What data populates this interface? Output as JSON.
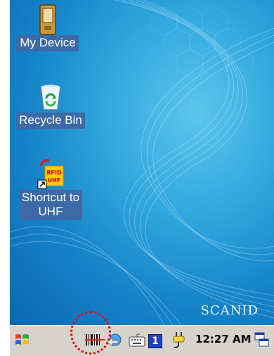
{
  "desktop": {
    "brand": "SCANID",
    "icons": [
      {
        "label": "My Device",
        "icon": "pda-device-icon"
      },
      {
        "label": "Recycle Bin",
        "icon": "recycle-bin-icon"
      },
      {
        "label": "Shortcut to\nUHF",
        "icon": "rfid-uhf-shortcut-icon",
        "badge_line1": "RFID",
        "badge_line2": "UHF"
      }
    ]
  },
  "taskbar": {
    "start_icon": "windows-flag-icon",
    "tray_icons": [
      "barcode-scanner-icon",
      "network-sync-icon",
      "keyboard-icon",
      "input-mode-icon",
      "power-plug-icon"
    ],
    "input_mode_label": "1",
    "time": "12:27 AM",
    "desktop_switch_icon": "windows-switch-icon"
  },
  "colors": {
    "label_bg": "#3d6aa6",
    "taskbar_bg": "#d7d3cc",
    "highlight": "#e01010"
  }
}
